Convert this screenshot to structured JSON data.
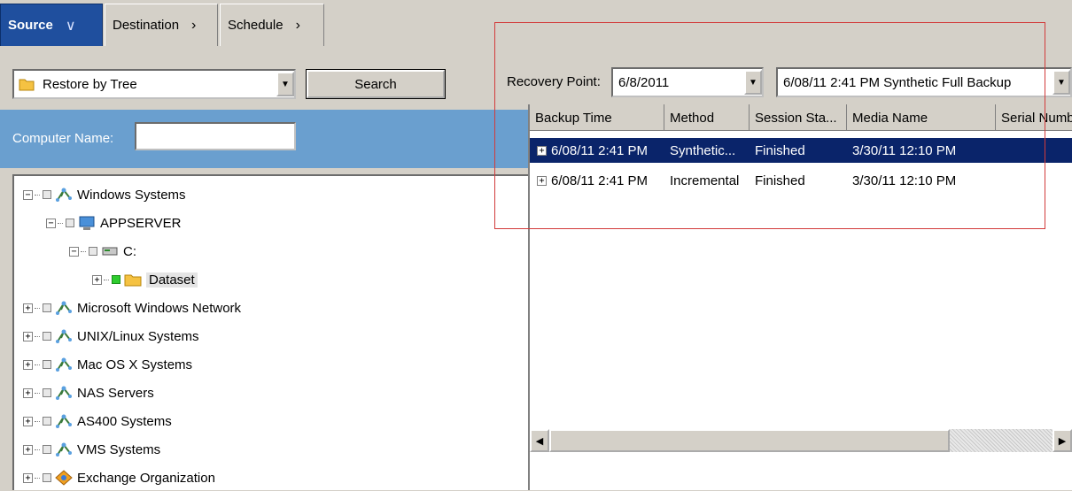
{
  "tabs": [
    {
      "label": "Source",
      "arrow": "∨"
    },
    {
      "label": "Destination",
      "arrow": "›"
    },
    {
      "label": "Schedule",
      "arrow": "›"
    }
  ],
  "restore_combo": {
    "value": "Restore by Tree",
    "icon": "folder-icon"
  },
  "search_button": {
    "label": "Search"
  },
  "computer_name": {
    "label": "Computer Name:",
    "value": ""
  },
  "tree": [
    {
      "label": "Windows Systems",
      "icon": "network-icon",
      "expander": "−"
    },
    {
      "label": "APPSERVER",
      "icon": "computer-icon",
      "expander": "−"
    },
    {
      "label": "C:",
      "icon": "drive-icon",
      "expander": "−"
    },
    {
      "label": "Dataset",
      "icon": "folder-icon",
      "expander": "+",
      "checked": true
    },
    {
      "label": "Microsoft Windows Network",
      "icon": "network-icon",
      "expander": "+"
    },
    {
      "label": "UNIX/Linux Systems",
      "icon": "network-icon",
      "expander": "+"
    },
    {
      "label": "Mac OS X Systems",
      "icon": "network-icon",
      "expander": "+"
    },
    {
      "label": "NAS Servers",
      "icon": "network-icon",
      "expander": "+"
    },
    {
      "label": "AS400 Systems",
      "icon": "network-icon",
      "expander": "+"
    },
    {
      "label": "VMS Systems",
      "icon": "network-icon",
      "expander": "+"
    },
    {
      "label": "Exchange Organization",
      "icon": "exchange-icon",
      "expander": "+"
    }
  ],
  "recovery_point": {
    "label": "Recovery Point:",
    "date": "6/8/2011",
    "session": "6/08/11  2:41 PM   Synthetic Full Backup"
  },
  "session_grid": {
    "columns": [
      "Backup Time",
      "Method",
      "Session Sta...",
      "Media Name",
      "Serial Numb"
    ],
    "rows": [
      {
        "expander": "+",
        "cells": [
          "6/08/11  2:41 PM",
          "Synthetic...",
          "Finished",
          "3/30/11 12:10 PM",
          ""
        ],
        "selected": true
      },
      {
        "expander": "+",
        "cells": [
          "6/08/11  2:41 PM",
          "Incremental",
          "Finished",
          "3/30/11 12:10 PM",
          ""
        ],
        "selected": false
      }
    ]
  },
  "colors": {
    "active_tab": "#1f4f9e",
    "band": "#6a9fcf",
    "selection": "#0a246a",
    "highlight_frame": "#d23b3b"
  }
}
